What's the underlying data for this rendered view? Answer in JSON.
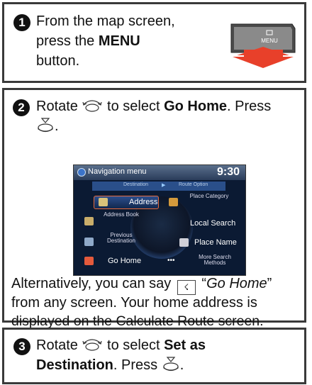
{
  "step1": {
    "number": "1",
    "line1": "From the map screen,",
    "line2_pre": "press the ",
    "line2_bold": "MENU",
    "line3": "button.",
    "key_label": "MENU"
  },
  "step2": {
    "number": "2",
    "line1_pre": "Rotate ",
    "line1_mid": " to select ",
    "line1_bold": "Go Home",
    "line1_post": ". Press",
    "line2_post": ".",
    "screen": {
      "title": "Navigation menu",
      "clock": "9:30",
      "tab_destination": "Destination",
      "tab_route": "Route Option",
      "address": "Address",
      "address_book": "Address Book",
      "previous_destination": "Previous Destination",
      "go_home": "Go Home",
      "place_category": "Place Category",
      "local_search": "Local Search",
      "place_name": "Place Name",
      "more_search": "More Search Methods",
      "more_dots": "•••"
    },
    "alt_line1_pre": "Alternatively, you can say ",
    "alt_line1_quote_open": " “",
    "alt_line1_italic": "Go Home",
    "alt_line1_quote_close": "”",
    "alt_line2": "from any screen. Your home address is",
    "alt_line3": "displayed on the Calculate Route screen."
  },
  "step3": {
    "number": "3",
    "line1_pre": "Rotate ",
    "line1_mid": " to select ",
    "line1_bold": "Set as",
    "line2_bold": "Destination",
    "line2_mid": ". Press ",
    "line2_post": "."
  }
}
